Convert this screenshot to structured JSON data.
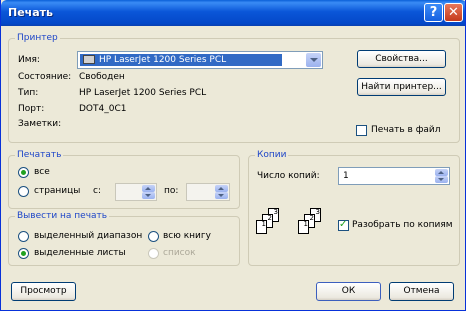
{
  "window": {
    "title": "Печать",
    "help_label": "?",
    "close_label": "✕"
  },
  "printer": {
    "legend": "Принтер",
    "name_label": "Имя:",
    "selected_printer": "HP LaserJet 1200 Series PCL",
    "status_label": "Состояние:",
    "status_value": "Свободен",
    "type_label": "Тип:",
    "type_value": "HP LaserJet 1200 Series PCL",
    "port_label": "Порт:",
    "port_value": "DOT4_0C1",
    "notes_label": "Заметки:",
    "properties_button": "Свойства...",
    "find_printer_button": "Найти принтер...",
    "print_to_file_label": "Печать в файл",
    "print_to_file_checked": false
  },
  "print_range": {
    "legend": "Печатать",
    "all_label": "все",
    "pages_label": "страницы",
    "from_label": "с:",
    "to_label": "по:",
    "selected": "all"
  },
  "print_what": {
    "legend": "Вывести на печать",
    "selected_range_label": "выделенный диапазон",
    "whole_book_label": "всю книгу",
    "selected_sheets_label": "выделенные листы",
    "list_label": "список",
    "selected": "selected_sheets"
  },
  "copies": {
    "legend": "Копии",
    "count_label": "Число копий:",
    "count_value": "1",
    "collate_label": "Разобрать по копиям",
    "collate_checked": true
  },
  "footer": {
    "preview_button": "Просмотр",
    "ok_button": "ОК",
    "cancel_button": "Отмена"
  },
  "colors": {
    "title_bar": "#0a56d8",
    "dialog_bg": "#ece9d8",
    "legend_text": "#1e46c8",
    "selection": "#316ac5"
  }
}
